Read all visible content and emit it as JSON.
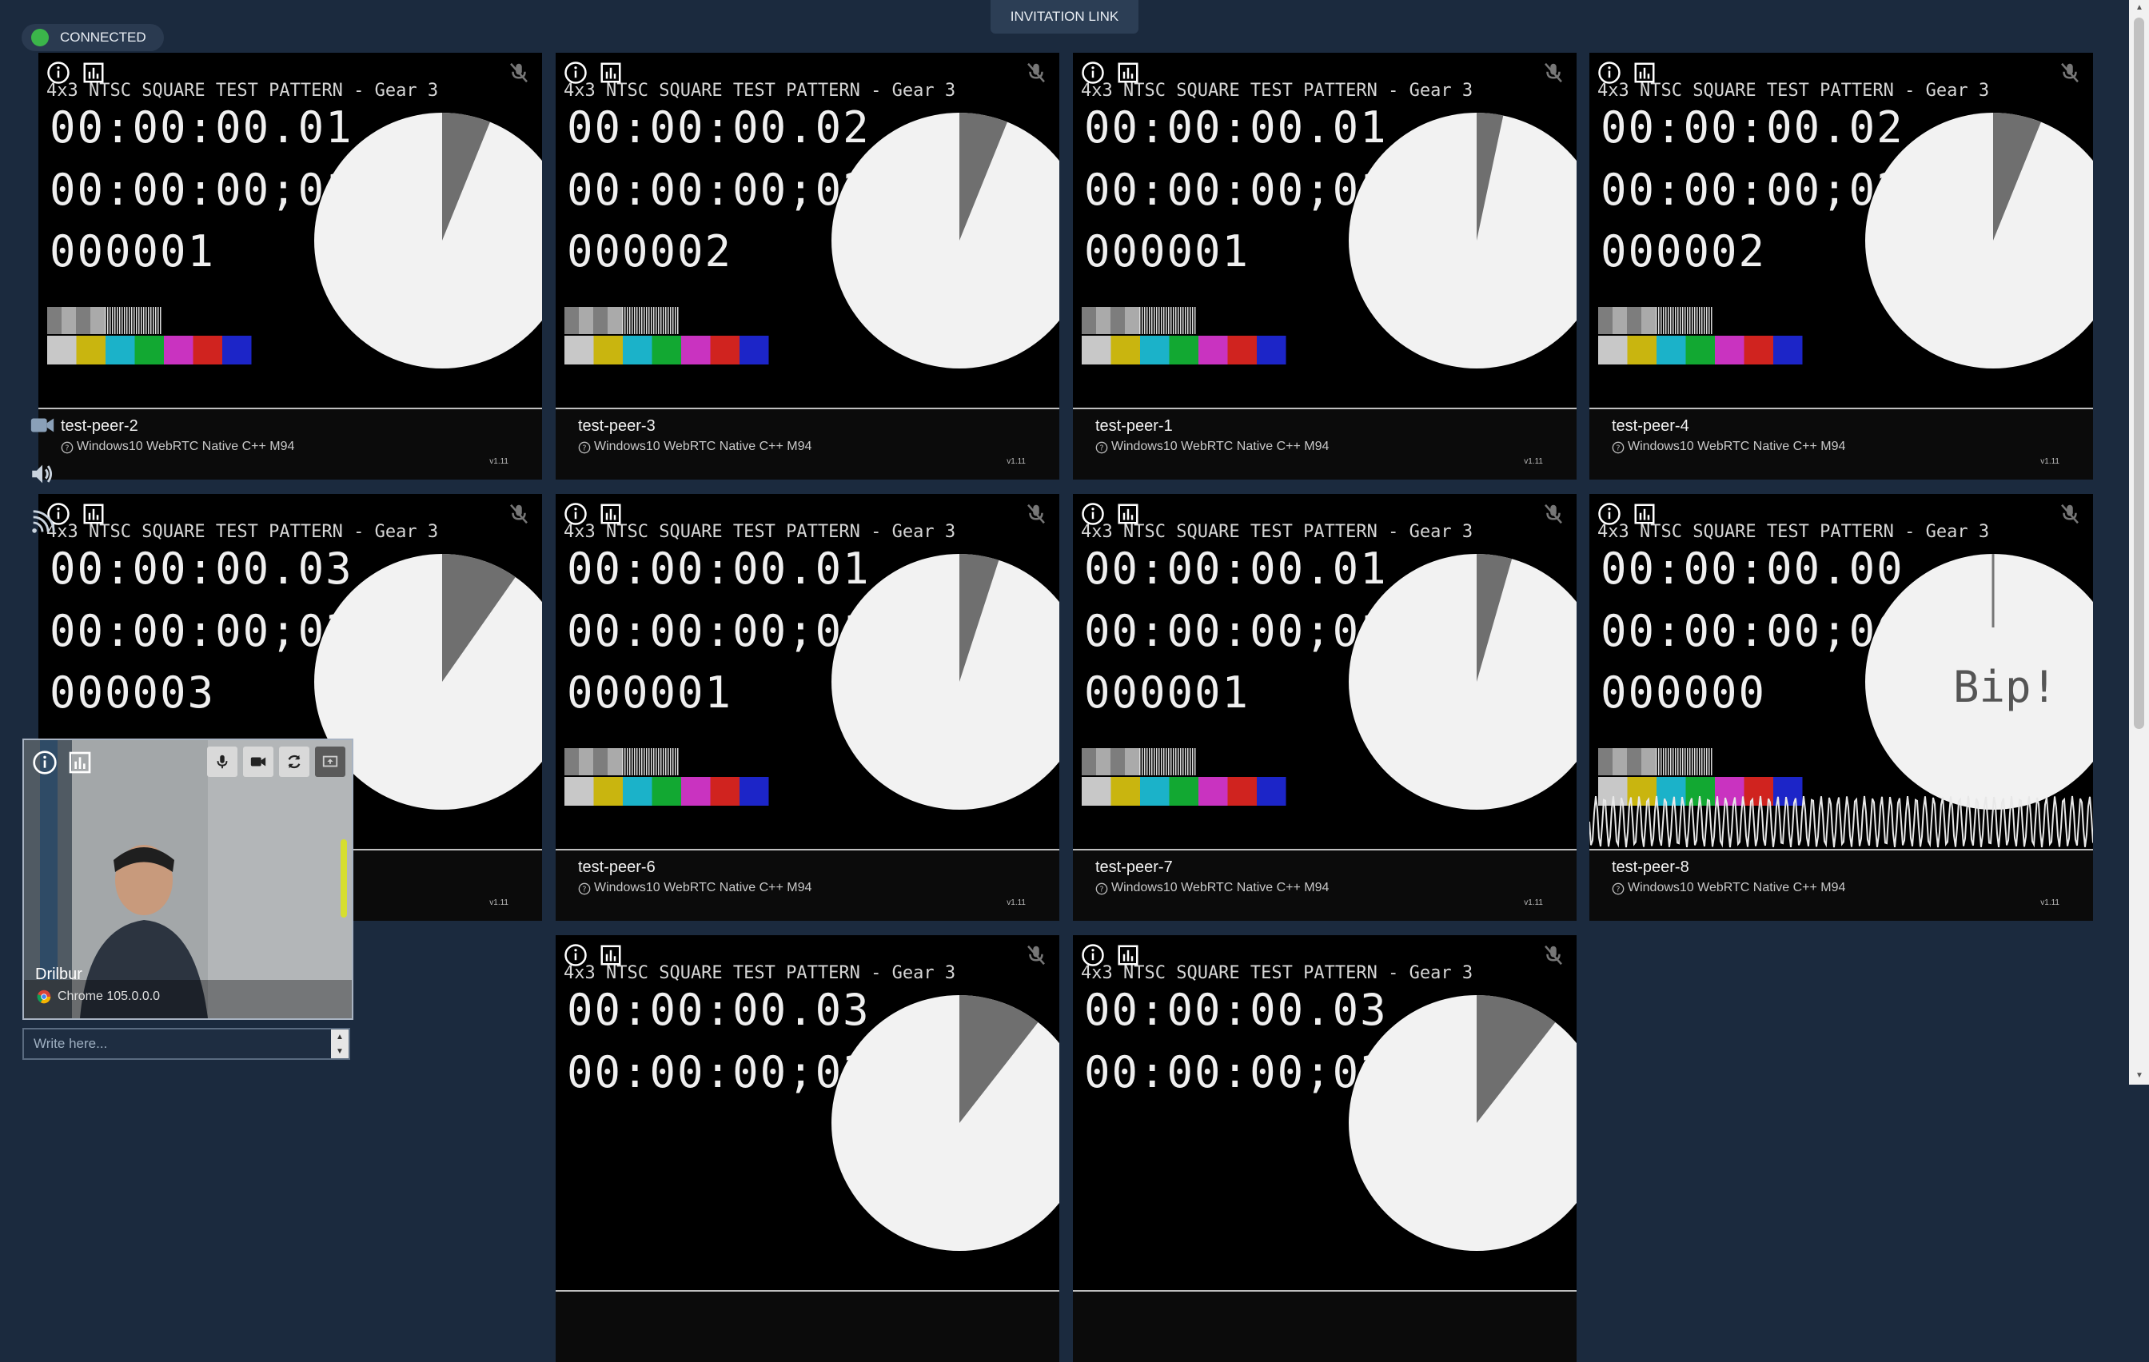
{
  "status": {
    "label": "CONNECTED",
    "color": "#3bb54a"
  },
  "invite_button": "INVITATION LINK",
  "test_pattern_title": "4x3 NTSC SQUARE TEST PATTERN - Gear 3",
  "client_label": "Windows10 WebRTC Native C++ M94",
  "version_label": "v1.11",
  "bip_label": "Bip!",
  "peers": [
    {
      "name": "test-peer-2",
      "timecode_drop": "00:00:00.01",
      "timecode_nondrop": "00:00:00;01",
      "frame": "000001"
    },
    {
      "name": "test-peer-3",
      "timecode_drop": "00:00:00.02",
      "timecode_nondrop": "00:00:00;02",
      "frame": "000002"
    },
    {
      "name": "test-peer-1",
      "timecode_drop": "00:00:00.01",
      "timecode_nondrop": "00:00:00;01",
      "frame": "000001"
    },
    {
      "name": "test-peer-4",
      "timecode_drop": "00:00:00.02",
      "timecode_nondrop": "00:00:00;02",
      "frame": "000002"
    },
    {
      "name": "",
      "timecode_drop": "00:00:00.03",
      "timecode_nondrop": "00:00:00;03",
      "frame": "000003"
    },
    {
      "name": "test-peer-6",
      "timecode_drop": "00:00:00.01",
      "timecode_nondrop": "00:00:00;01",
      "frame": "000001"
    },
    {
      "name": "test-peer-7",
      "timecode_drop": "00:00:00.01",
      "timecode_nondrop": "00:00:00;01",
      "frame": "000001"
    },
    {
      "name": "test-peer-8",
      "timecode_drop": "00:00:00.00",
      "timecode_nondrop": "00:00:00;00",
      "frame": "000000"
    },
    {
      "name": "",
      "timecode_drop": "00:00:00.03",
      "timecode_nondrop": "00:00:00;03",
      "frame": ""
    },
    {
      "name": "",
      "timecode_drop": "00:00:00.03",
      "timecode_nondrop": "00:00:00;03",
      "frame": ""
    }
  ],
  "local": {
    "name": "Drilbur",
    "browser": "Chrome 105.0.0.0"
  },
  "chat": {
    "placeholder": "Write here..."
  },
  "icons": {
    "tile": [
      "info-icon",
      "stats-icon",
      "mic-muted-icon"
    ],
    "sidebar": [
      "camera-icon",
      "speaker-icon",
      "wifi-icon"
    ],
    "local_controls": [
      "mic-icon",
      "camera-icon",
      "switch-camera-icon",
      "screen-share-icon"
    ]
  }
}
